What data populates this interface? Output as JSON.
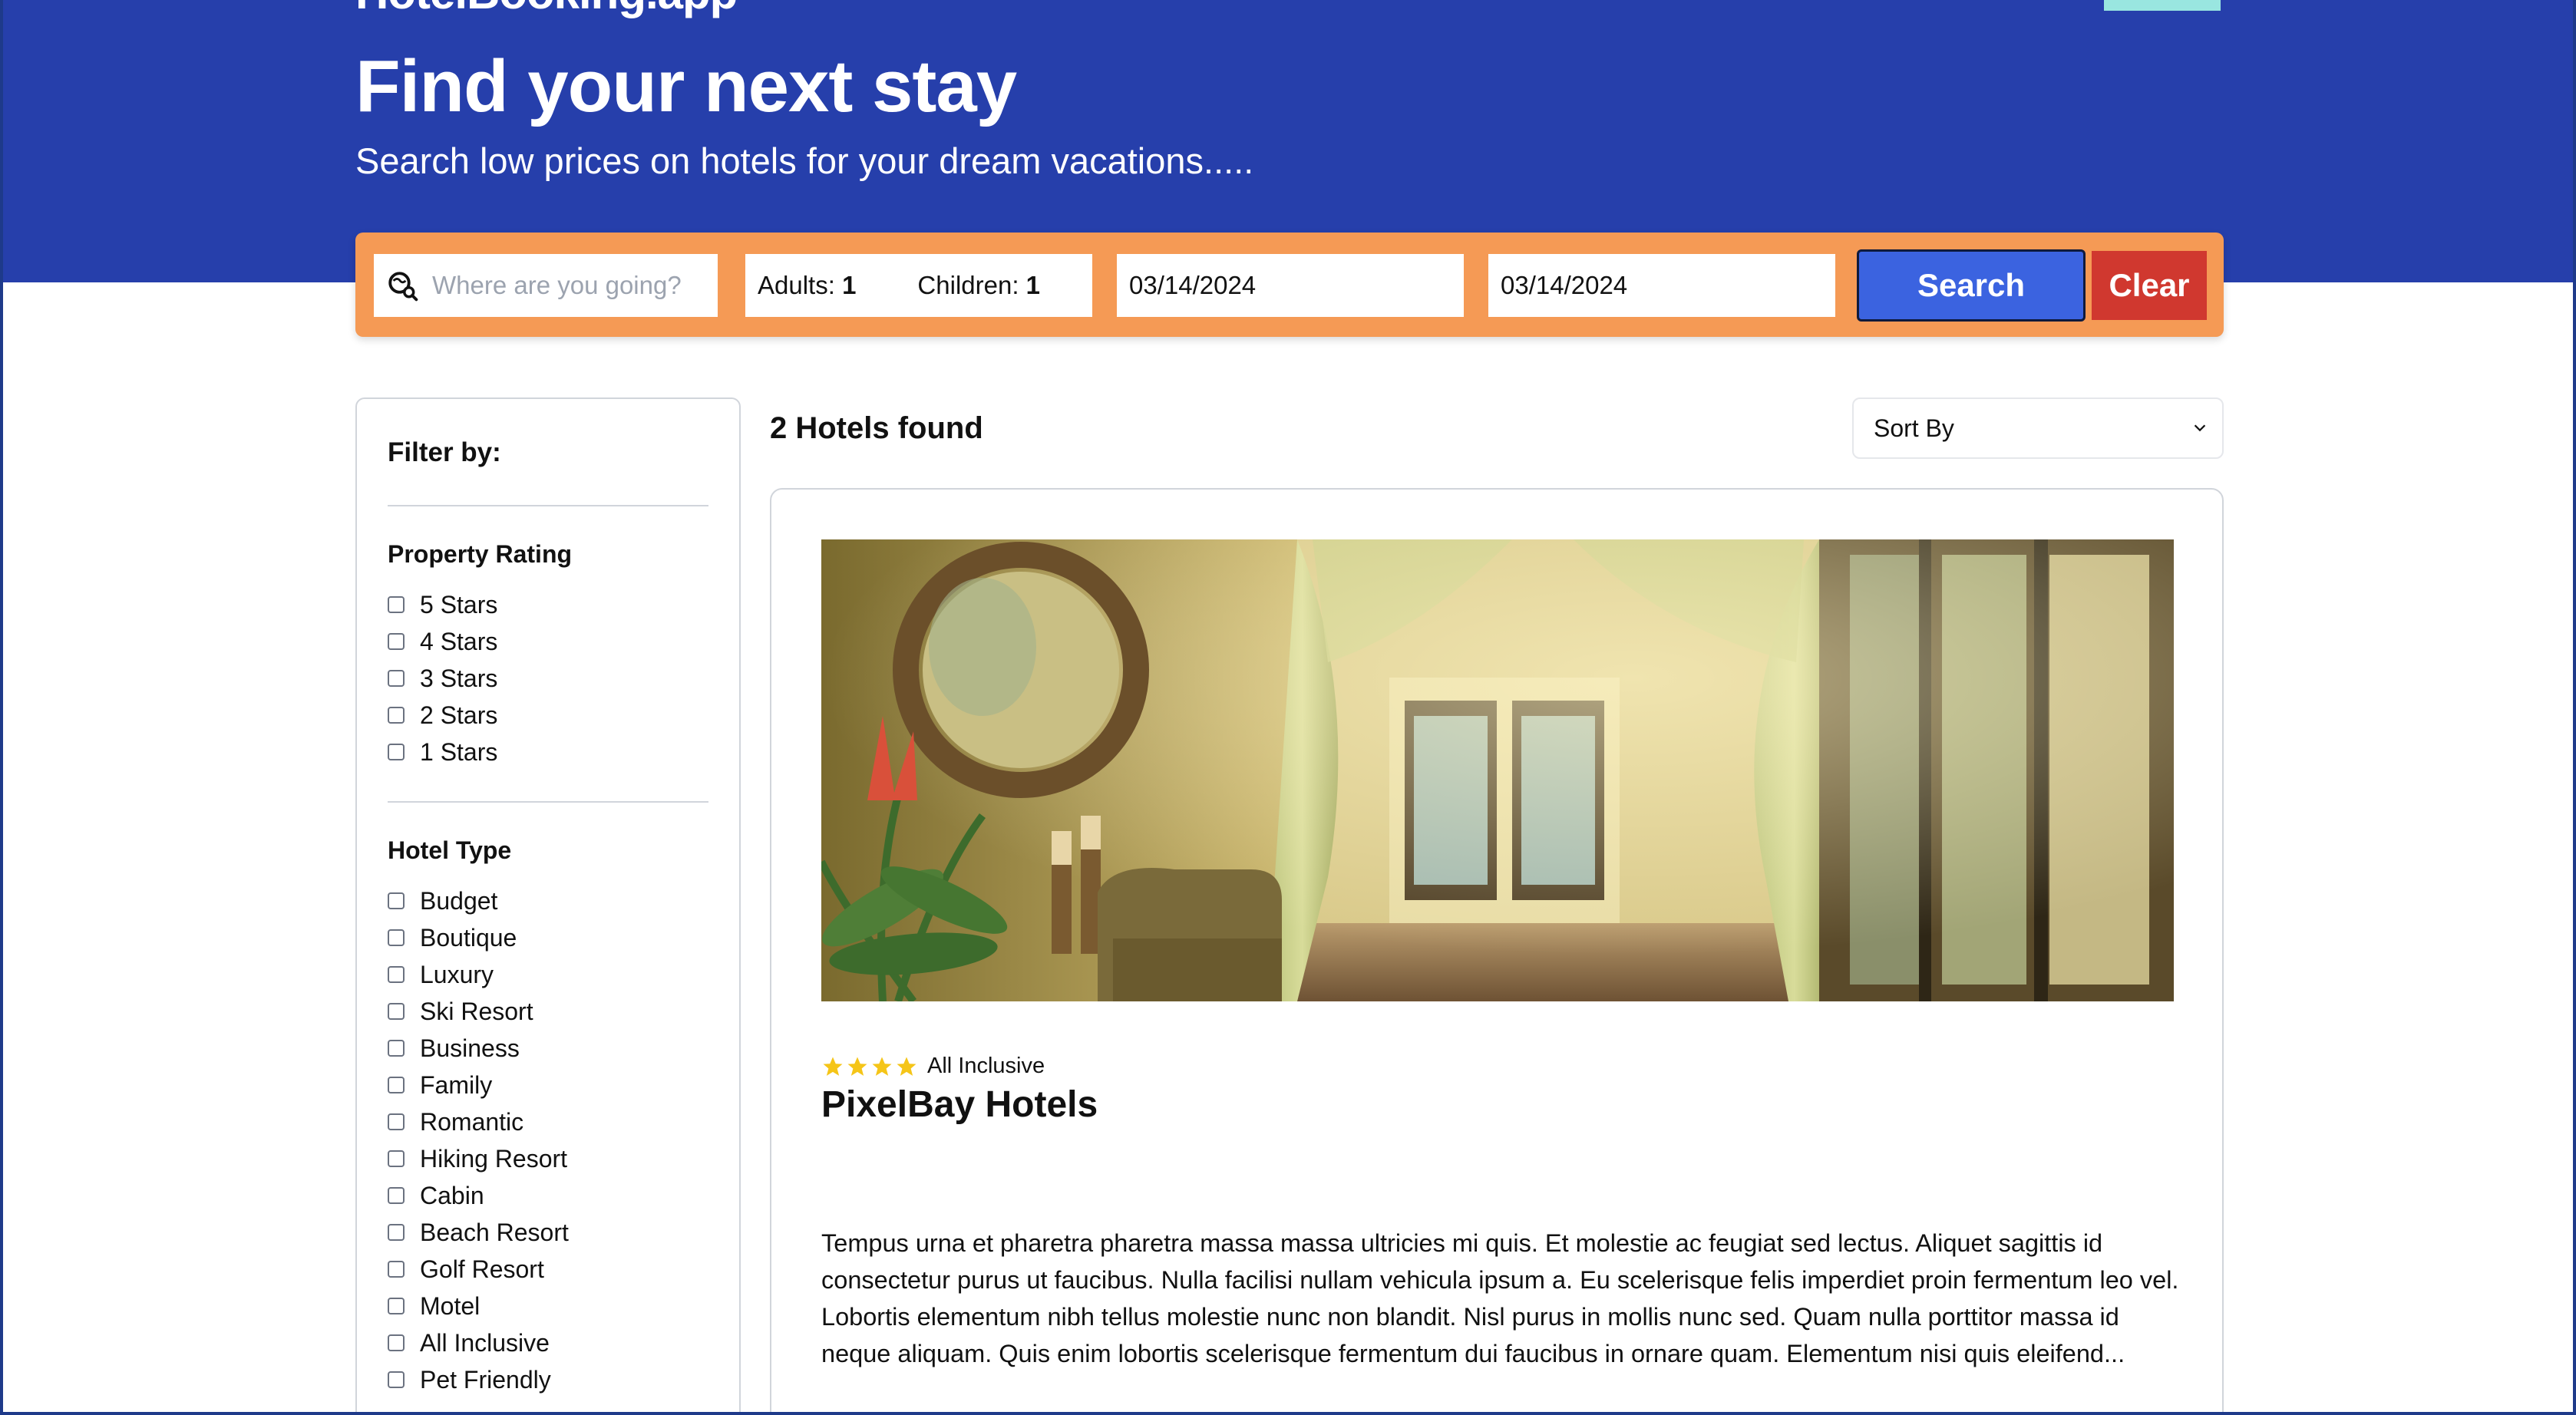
{
  "header": {
    "logo": "HotelBooking.app",
    "title": "Find your next stay",
    "subtitle": "Search low prices on hotels for your dream vacations....."
  },
  "search": {
    "destination_placeholder": "Where are you going?",
    "adults_label": "Adults:",
    "adults_value": "1",
    "children_label": "Children:",
    "children_value": "1",
    "check_in": "03/14/2024",
    "check_out": "03/14/2024",
    "search_label": "Search",
    "clear_label": "Clear"
  },
  "filters": {
    "title": "Filter by:",
    "rating": {
      "title": "Property Rating",
      "options": [
        "5 Stars",
        "4 Stars",
        "3 Stars",
        "2 Stars",
        "1 Stars"
      ]
    },
    "hotel_type": {
      "title": "Hotel Type",
      "options": [
        "Budget",
        "Boutique",
        "Luxury",
        "Ski Resort",
        "Business",
        "Family",
        "Romantic",
        "Hiking Resort",
        "Cabin",
        "Beach Resort",
        "Golf Resort",
        "Motel",
        "All Inclusive",
        "Pet Friendly"
      ]
    }
  },
  "results": {
    "count_text": "2 Hotels found",
    "sort_label": "Sort By"
  },
  "hotel": {
    "star_rating": 4,
    "type": "All Inclusive",
    "name": "PixelBay Hotels",
    "description": "Tempus urna et pharetra pharetra massa massa ultricies mi quis. Et molestie ac feugiat sed lectus. Aliquet sagittis id consectetur purus ut faucibus. Nulla facilisi nullam vehicula ipsum a. Eu scelerisque felis imperdiet proin fermentum leo vel. Lobortis elementum nibh tellus molestie nunc non blandit. Nisl purus in mollis nunc sed. Quam nulla porttitor massa id neque aliquam. Quis enim lobortis scelerisque fermentum dui faucibus in ornare quam. Elementum nisi quis eleifend..."
  },
  "colors": {
    "hero": "#263fab",
    "searchbar": "#f59a55",
    "search_button": "#3b63e0",
    "clear_button": "#d0382f",
    "star": "#f5c518"
  }
}
